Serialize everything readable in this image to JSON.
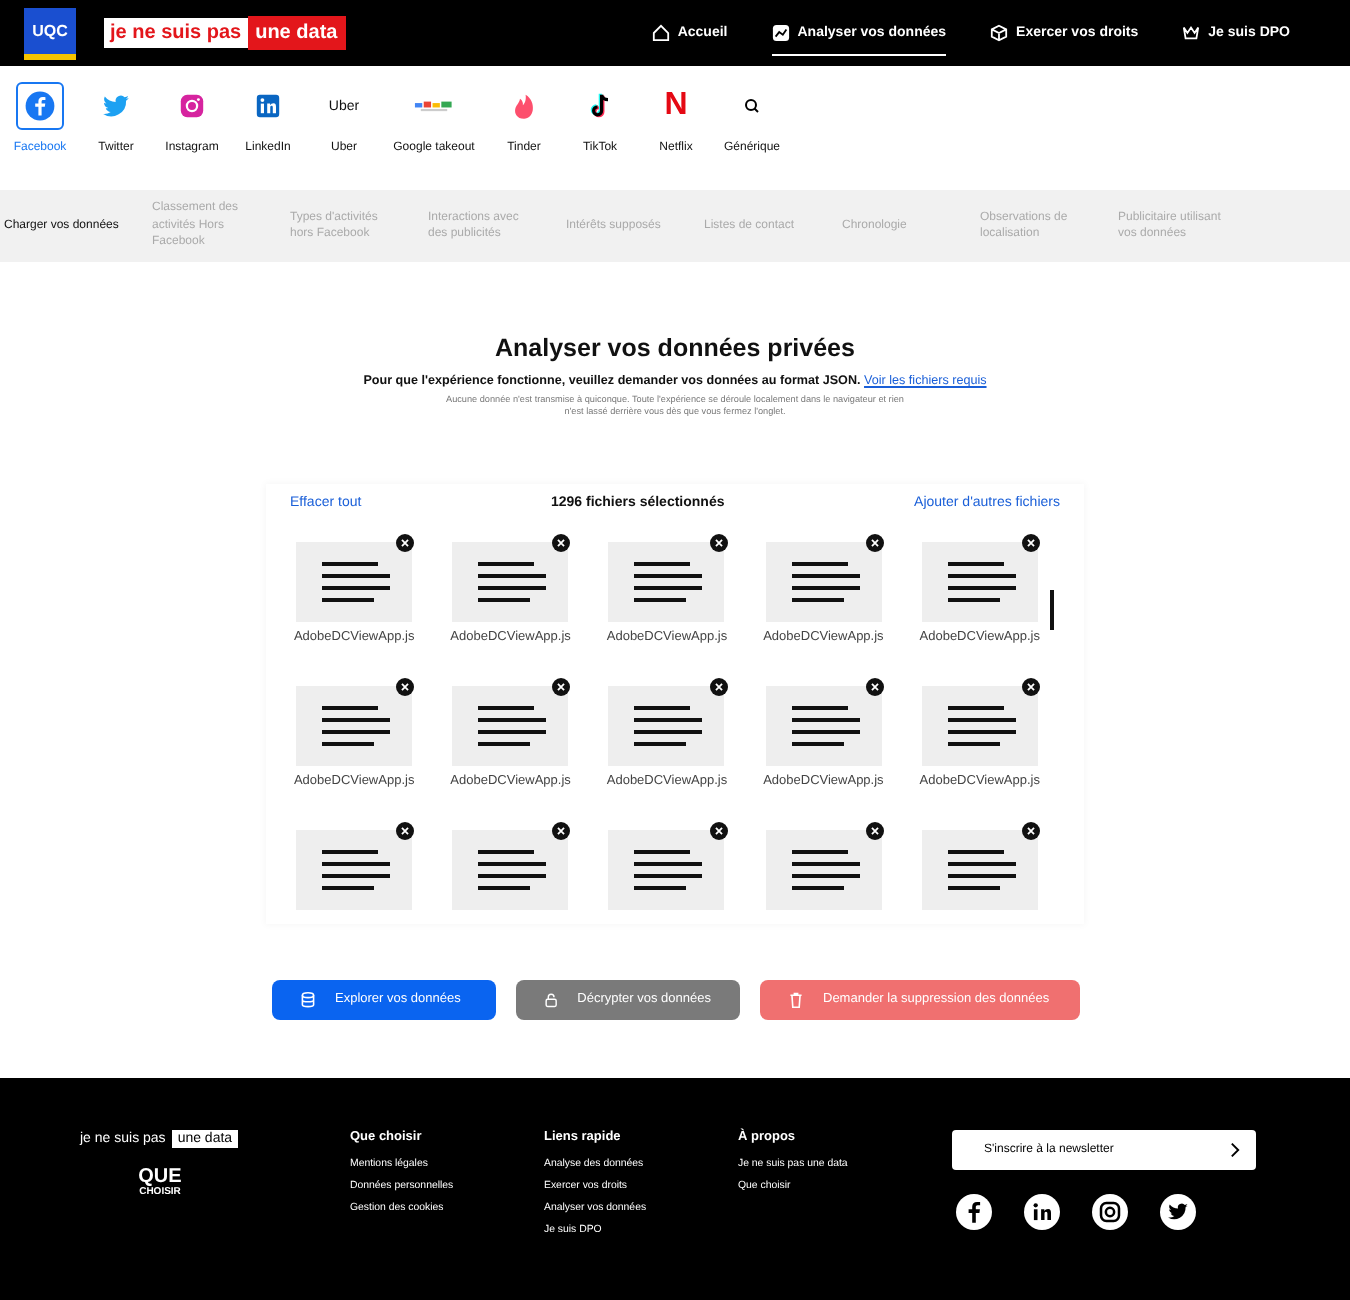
{
  "header": {
    "logo_text": "UQC",
    "tagline": {
      "part1": "je ne suis pas",
      "part2": "une data"
    },
    "nav": [
      {
        "label": "Accueil",
        "kind": "home",
        "selected": false
      },
      {
        "label": "Analyser vos données",
        "kind": "chart",
        "selected": true
      },
      {
        "label": "Exercer vos droits",
        "kind": "cube",
        "selected": false
      },
      {
        "label": "Je suis DPO",
        "kind": "crown",
        "selected": false
      }
    ]
  },
  "services": [
    {
      "label": "Facebook",
      "kind": "facebook",
      "selected": true
    },
    {
      "label": "Twitter",
      "kind": "twitter",
      "selected": false
    },
    {
      "label": "Instagram",
      "kind": "instagram",
      "selected": false
    },
    {
      "label": "LinkedIn",
      "kind": "linkedin",
      "selected": false
    },
    {
      "label": "Uber",
      "kind": "text",
      "logo_text": "Uber",
      "selected": false
    },
    {
      "label": "Google takeout",
      "kind": "google",
      "selected": false
    },
    {
      "label": "Tinder",
      "kind": "tinder",
      "selected": false
    },
    {
      "label": "TikTok",
      "kind": "tiktok",
      "selected": false
    },
    {
      "label": "Netflix",
      "kind": "netflix",
      "logo_text": "N",
      "selected": false
    },
    {
      "label": "Générique",
      "kind": "search",
      "selected": false
    }
  ],
  "steps": [
    {
      "label": "Charger vos données",
      "selected": true
    },
    {
      "label": "Classement des activités Hors Facebook",
      "selected": false
    },
    {
      "label": "Types d'activités hors Facebook",
      "selected": false
    },
    {
      "label": "Interactions avec des publicités",
      "selected": false
    },
    {
      "label": "Intérêts supposés",
      "selected": false
    },
    {
      "label": "Listes de contact",
      "selected": false
    },
    {
      "label": "Chronologie",
      "selected": false
    },
    {
      "label": "Observations de localisation",
      "selected": false
    },
    {
      "label": "Publicitaire utilisant vos données",
      "selected": false
    }
  ],
  "main": {
    "title": "Analyser vos données privées",
    "intro": "Pour que l'expérience fonctionne, veuillez demander vos données au format JSON.",
    "intro_link": "Voir les fichiers requis",
    "note": "Aucune donnée n'est transmise à quiconque. Toute l'expérience se déroule localement dans le navigateur et rien n'est lassé derrière vous dès que vous fermez l'onglet."
  },
  "files_panel": {
    "clear": "Effacer tout",
    "count": "1296 fichiers sélectionnés",
    "add": "Ajouter d'autres fichiers",
    "files": [
      {
        "kind": "full",
        "name": "AdobeDCViewApp.js"
      },
      {
        "kind": "full",
        "name": "AdobeDCViewApp.js"
      },
      {
        "kind": "full",
        "name": "AdobeDCViewApp.js"
      },
      {
        "kind": "full",
        "name": "AdobeDCViewApp.js"
      },
      {
        "kind": "full",
        "name": "AdobeDCViewApp.js"
      },
      {
        "kind": "full",
        "name": "AdobeDCViewApp.js"
      },
      {
        "kind": "full",
        "name": "AdobeDCViewApp.js"
      },
      {
        "kind": "full",
        "name": "AdobeDCViewApp.js"
      },
      {
        "kind": "full",
        "name": "AdobeDCViewApp.js"
      },
      {
        "kind": "full",
        "name": "AdobeDCViewApp.js"
      },
      {
        "kind": "cut"
      },
      {
        "kind": "cut"
      },
      {
        "kind": "cut"
      },
      {
        "kind": "cut"
      },
      {
        "kind": "cut"
      }
    ]
  },
  "actions": [
    {
      "label": "Explorer vos données",
      "kind": "explore"
    },
    {
      "label": "Décrypter vos données",
      "kind": "decrypt"
    },
    {
      "label": "Demander la suppression des données",
      "kind": "delete"
    }
  ],
  "footer": {
    "tagline": {
      "part1": "je ne suis pas",
      "part2": "une data"
    },
    "logo": {
      "line1": "QUE",
      "line2": "CHOISIR"
    },
    "columns": [
      {
        "title": "Que choisir",
        "links": [
          "Mentions légales",
          "Données personnelles",
          "Gestion des cookies"
        ]
      },
      {
        "title": "Liens rapide",
        "links": [
          "Analyse des données",
          "Exercer vos droits",
          "Analyser vos données",
          "Je suis DPO"
        ]
      },
      {
        "title": "À propos",
        "links": [
          "Je ne suis pas une data",
          "Que choisir"
        ]
      }
    ],
    "newsletter": "S'inscrire à la newsletter",
    "social": [
      {
        "kind": "facebook"
      },
      {
        "kind": "linkedin"
      },
      {
        "kind": "instagram"
      },
      {
        "kind": "twitter"
      }
    ]
  }
}
